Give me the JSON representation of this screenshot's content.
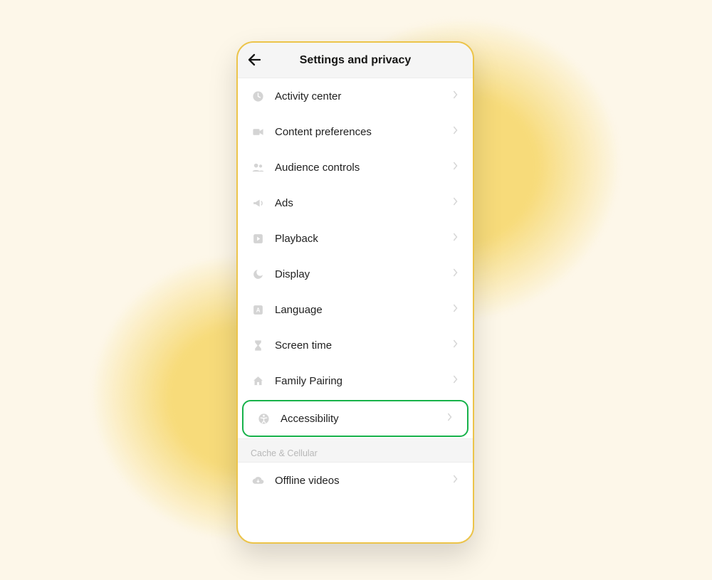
{
  "header": {
    "title": "Settings and privacy"
  },
  "items": [
    {
      "icon": "clock-icon",
      "label": "Activity center"
    },
    {
      "icon": "video-icon",
      "label": "Content preferences"
    },
    {
      "icon": "people-icon",
      "label": "Audience controls"
    },
    {
      "icon": "megaphone-icon",
      "label": "Ads"
    },
    {
      "icon": "play-square-icon",
      "label": "Playback"
    },
    {
      "icon": "moon-icon",
      "label": "Display"
    },
    {
      "icon": "language-icon",
      "label": "Language"
    },
    {
      "icon": "hourglass-icon",
      "label": "Screen time"
    },
    {
      "icon": "home-icon",
      "label": "Family Pairing"
    },
    {
      "icon": "accessibility-icon",
      "label": "Accessibility",
      "highlighted": true
    }
  ],
  "section2": {
    "title": "Cache & Cellular",
    "items": [
      {
        "icon": "cloud-download-icon",
        "label": "Offline videos"
      }
    ]
  },
  "colors": {
    "highlight": "#17b24a",
    "accent": "#ecc44a",
    "bg": "#fdf7e9",
    "iconGray": "#c7c7c7",
    "chevGray": "#d6d6d6"
  }
}
